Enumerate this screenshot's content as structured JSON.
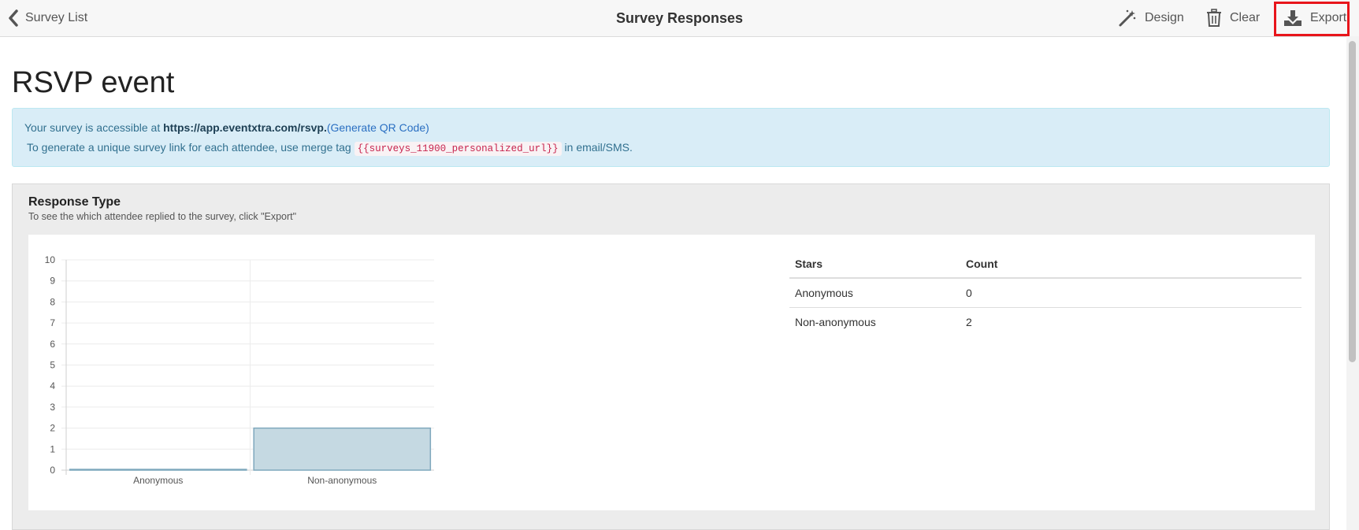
{
  "topbar": {
    "back_label": "Survey List",
    "title": "Survey Responses",
    "design_label": "Design",
    "clear_label": "Clear",
    "export_label": "Export"
  },
  "survey_name": "RSVP event",
  "info": {
    "prefix": "Your survey is accessible at ",
    "url": "https://app.eventxtra.com/rsvp",
    "dot": ".",
    "qr_link": "(Generate QR Code)",
    "line2_prefix": "To generate a unique survey link for each attendee, use merge tag ",
    "merge_tag": "{{surveys_11900_personalized_url}}",
    "line2_suffix": " in email/SMS."
  },
  "panel": {
    "title": "Response Type",
    "subtitle": "To see the which attendee replied to the survey, click \"Export\""
  },
  "table": {
    "headers": [
      "Stars",
      "Count"
    ],
    "rows": [
      [
        "Anonymous",
        "0"
      ],
      [
        "Non-anonymous",
        "2"
      ]
    ]
  },
  "chart_data": {
    "type": "bar",
    "categories": [
      "Anonymous",
      "Non-anonymous"
    ],
    "values": [
      0,
      2
    ],
    "ylim": [
      0,
      10
    ],
    "yticks": [
      "0",
      "1",
      "2",
      "3",
      "4",
      "5",
      "6",
      "7",
      "8",
      "9",
      "10"
    ],
    "grid": true,
    "bar_color": "#c5d9e2",
    "bar_border": "#7fa8bd"
  }
}
